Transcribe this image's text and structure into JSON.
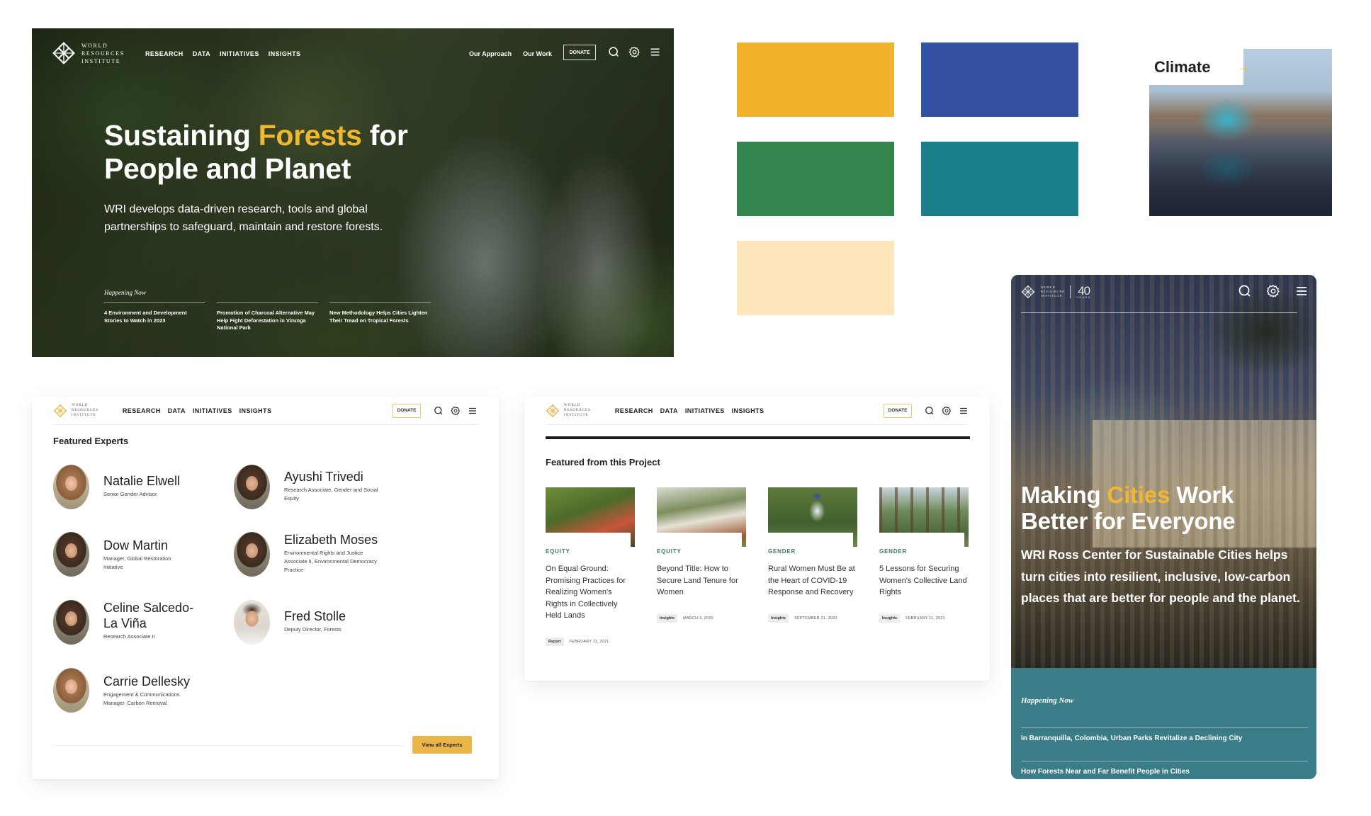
{
  "brand": {
    "logo_lines": [
      "WORLD",
      "RESOURCES",
      "INSTITUTE"
    ],
    "anniversary_number": "40",
    "anniversary_label": "YEARS"
  },
  "nav": {
    "items": [
      "RESEARCH",
      "DATA",
      "INITIATIVES",
      "INSIGHTS"
    ],
    "links": [
      "Our Approach",
      "Our Work"
    ],
    "donate_label": "DONATE",
    "icons": [
      "search-icon",
      "gear-icon",
      "menu-icon"
    ]
  },
  "hero": {
    "title_before": "Sustaining ",
    "title_accent": "Forests",
    "title_after": " for",
    "title_line2": "People and Planet",
    "subtitle": "WRI develops data-driven research, tools and global partnerships to safeguard, maintain and restore forests.",
    "happening_label": "Happening Now",
    "news": [
      "4 Environment and Development Stories to Watch in 2023",
      "Promotion of Charcoal Alternative May Help Fight Deforestation in Virunga National Park",
      "New Methodology Helps Cities Lighten Their Tread on Tropical Forests"
    ]
  },
  "palette": {
    "swatches": [
      {
        "name": "yellow",
        "color": "#f2b22b"
      },
      {
        "name": "blue",
        "color": "#3451a2"
      },
      {
        "name": "green",
        "color": "#33854d"
      },
      {
        "name": "teal",
        "color": "#1c7f8c"
      },
      {
        "name": "cream",
        "color": "#fde6bc"
      }
    ],
    "accent": "#f0b731",
    "category_green": "#3f7a56",
    "teal_panel": "#3a7c88"
  },
  "climate_card": {
    "label": "Climate",
    "arrow": "→"
  },
  "experts": {
    "heading": "Featured Experts",
    "people": [
      {
        "name": "Natalie Elwell",
        "role": "Senior Gender Advisor"
      },
      {
        "name": "Ayushi Trivedi",
        "role": "Research Associate, Gender and Social Equity"
      },
      {
        "name": "Dow Martin",
        "role": "Manager, Global Restoration Initiative"
      },
      {
        "name": "Elizabeth Moses",
        "role": "Environmental Rights and Justice Associate II, Environmental Democracy Practice"
      },
      {
        "name": "Celine Salcedo-La Viña",
        "role": "Research Associate II"
      },
      {
        "name": "Fred Stolle",
        "role": "Deputy Director, Forests"
      },
      {
        "name": "Carrie Dellesky",
        "role": "Engagement & Communications Manager, Carbon Removal"
      }
    ],
    "view_all_label": "View all Experts"
  },
  "project": {
    "heading": "Featured from this Project",
    "cards": [
      {
        "category": "EQUITY",
        "title": "On Equal Ground: Promising Practices for Realizing Women's Rights in Collectively Held Lands",
        "tag": "Report",
        "date": "FEBRUARY 11, 2021"
      },
      {
        "category": "EQUITY",
        "title": "Beyond Title: How to Secure Land Tenure for Women",
        "tag": "Insights",
        "date": "MARCH 3, 2020"
      },
      {
        "category": "GENDER",
        "title": "Rural Women Must Be at the Heart of COVID-19 Response and Recovery",
        "tag": "Insights",
        "date": "SEPTEMBER 21, 2020"
      },
      {
        "category": "GENDER",
        "title": "5 Lessons for Securing Women's Collective Land Rights",
        "tag": "Insights",
        "date": "FEBRUARY 11, 2021"
      }
    ]
  },
  "mobile": {
    "title_before": "Making ",
    "title_accent": "Cities",
    "title_after": " Work",
    "title_line2": "Better for Everyone",
    "subtitle": "WRI Ross Center for Sustainable Cities helps turn cities into resilient, inclusive, low-carbon places that are better for people and the planet.",
    "happening_label": "Happening Now",
    "news": [
      "In Barranquilla, Colombia, Urban Parks Revitalize a Declining City",
      "How Forests Near and Far Benefit People in Cities"
    ]
  }
}
